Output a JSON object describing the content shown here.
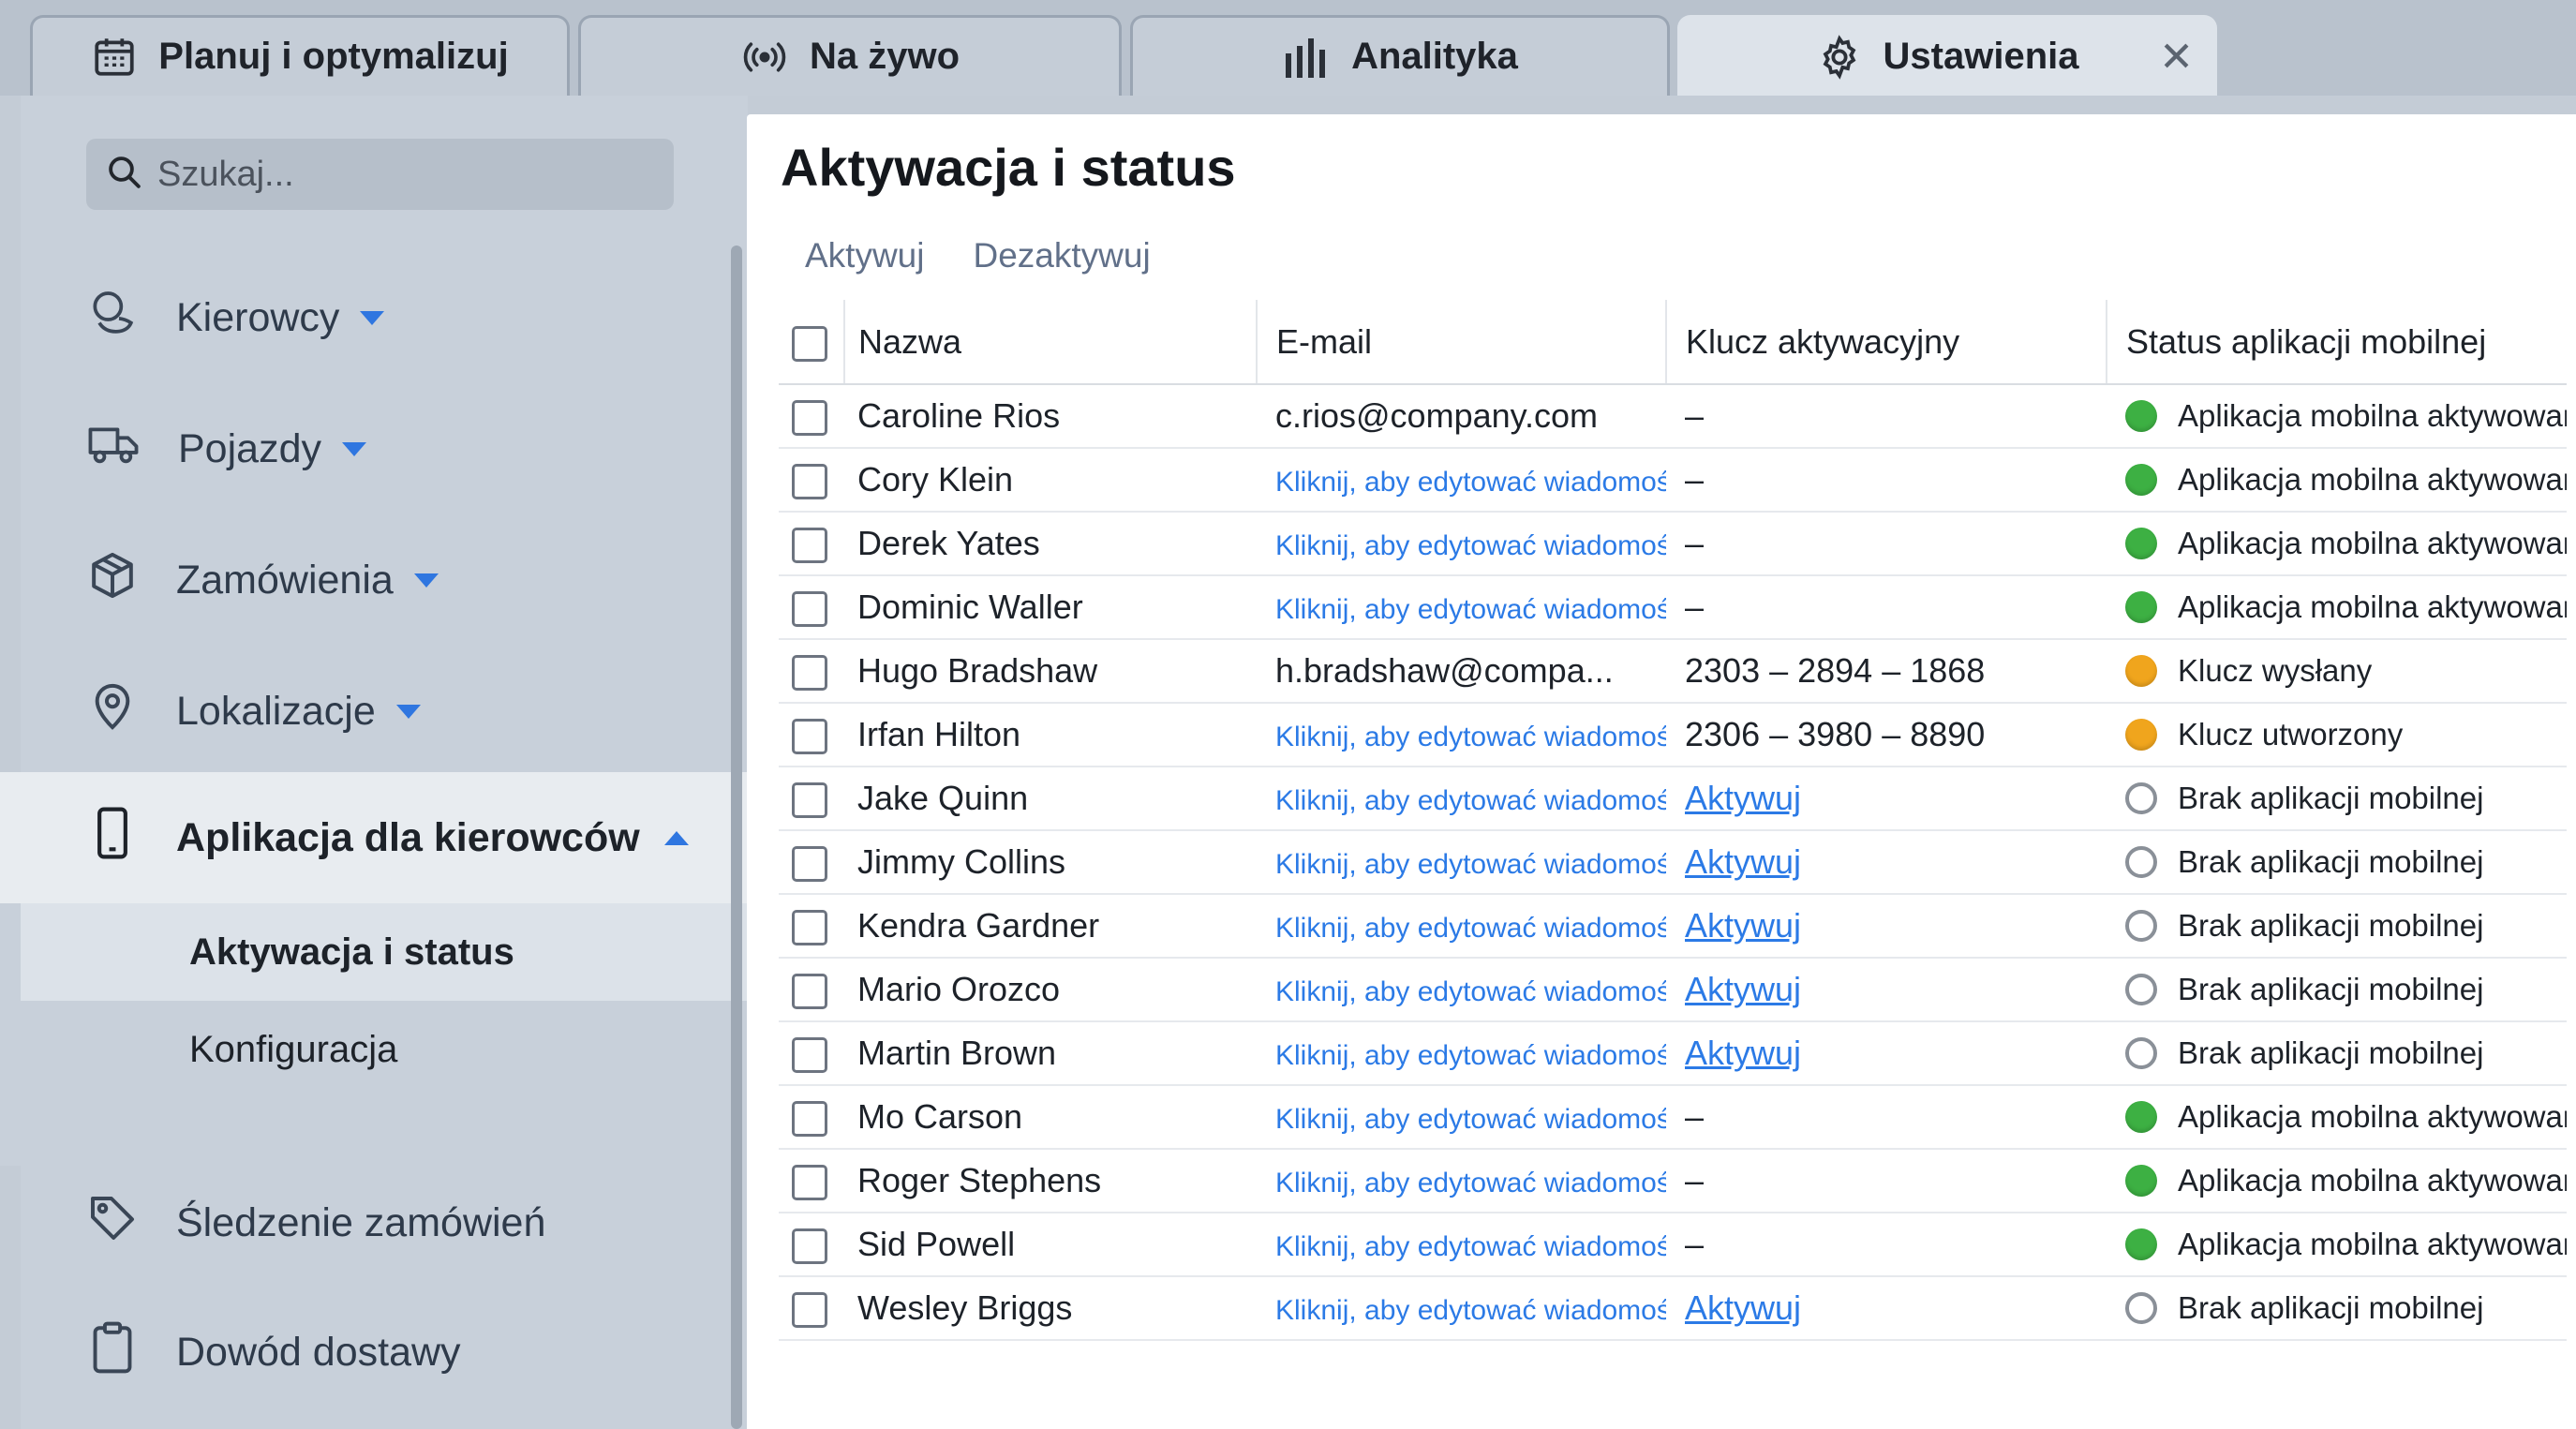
{
  "tabs": [
    {
      "label": "Planuj i optymalizuj",
      "icon": "calendar-icon"
    },
    {
      "label": "Na żywo",
      "icon": "broadcast-icon"
    },
    {
      "label": "Analityka",
      "icon": "bar-chart-icon"
    },
    {
      "label": "Ustawienia",
      "icon": "gear-icon",
      "active": true,
      "close": "✕"
    }
  ],
  "sidebar": {
    "search_placeholder": "Szukaj...",
    "items": [
      {
        "label": "Kierowcy",
        "icon": "drivers-icon"
      },
      {
        "label": "Pojazdy",
        "icon": "truck-icon"
      },
      {
        "label": "Zamówienia",
        "icon": "box-icon"
      },
      {
        "label": "Lokalizacje",
        "icon": "location-pin-icon"
      },
      {
        "label": "Aplikacja dla kierowców",
        "icon": "phone-icon"
      },
      {
        "label": "Śledzenie zamówień",
        "icon": "tag-icon"
      },
      {
        "label": "Dowód dostawy",
        "icon": "clipboard-icon"
      }
    ],
    "subitems": [
      {
        "label": "Aktywacja i status",
        "active": true
      },
      {
        "label": "Konfiguracja"
      }
    ]
  },
  "main": {
    "title": "Aktywacja i status",
    "actions": {
      "activate": "Aktywuj",
      "deactivate": "Dezaktywuj"
    },
    "columns": {
      "name": "Nazwa",
      "email": "E-mail",
      "key": "Klucz aktywacyjny",
      "status": "Status aplikacji mobilnej"
    },
    "rows": [
      {
        "name": "Caroline Rios",
        "email": "c.rios@company.com",
        "email_link": false,
        "key": "–",
        "key_link": false,
        "status": "Aplikacja mobilna aktywowana",
        "status_color": "green"
      },
      {
        "name": "Cory Klein",
        "email": "Kliknij, aby edytować wiadomość e-mail",
        "email_link": true,
        "key": "–",
        "key_link": false,
        "status": "Aplikacja mobilna aktywowana",
        "status_color": "green"
      },
      {
        "name": "Derek Yates",
        "email": "Kliknij, aby edytować wiadomość e-mail",
        "email_link": true,
        "key": "–",
        "key_link": false,
        "status": "Aplikacja mobilna aktywowana",
        "status_color": "green"
      },
      {
        "name": "Dominic Waller",
        "email": "Kliknij, aby edytować wiadomość e-mail",
        "email_link": true,
        "key": "–",
        "key_link": false,
        "status": "Aplikacja mobilna aktywowana",
        "status_color": "green"
      },
      {
        "name": "Hugo Bradshaw",
        "email": "h.bradshaw@compa...",
        "email_link": false,
        "key": "2303 – 2894 – 1868",
        "key_link": false,
        "status": "Klucz wysłany",
        "status_color": "orange"
      },
      {
        "name": "Irfan Hilton",
        "email": "Kliknij, aby edytować wiadomość e-mail",
        "email_link": true,
        "key": "2306 – 3980 – 8890",
        "key_link": false,
        "status": "Klucz utworzony",
        "status_color": "orange"
      },
      {
        "name": "Jake Quinn",
        "email": "Kliknij, aby edytować wiadomość e-mail",
        "email_link": true,
        "key": "Aktywuj",
        "key_link": true,
        "status": "Brak aplikacji mobilnej",
        "status_color": "empty"
      },
      {
        "name": "Jimmy Collins",
        "email": "Kliknij, aby edytować wiadomość e-mail",
        "email_link": true,
        "key": "Aktywuj",
        "key_link": true,
        "status": "Brak aplikacji mobilnej",
        "status_color": "empty"
      },
      {
        "name": "Kendra Gardner",
        "email": "Kliknij, aby edytować wiadomość e-mail",
        "email_link": true,
        "key": "Aktywuj",
        "key_link": true,
        "status": "Brak aplikacji mobilnej",
        "status_color": "empty"
      },
      {
        "name": "Mario Orozco",
        "email": "Kliknij, aby edytować wiadomość e-mail",
        "email_link": true,
        "key": "Aktywuj",
        "key_link": true,
        "status": "Brak aplikacji mobilnej",
        "status_color": "empty"
      },
      {
        "name": "Martin Brown",
        "email": "Kliknij, aby edytować wiadomość e-mail",
        "email_link": true,
        "key": "Aktywuj",
        "key_link": true,
        "status": "Brak aplikacji mobilnej",
        "status_color": "empty"
      },
      {
        "name": "Mo Carson",
        "email": "Kliknij, aby edytować wiadomość e-mail",
        "email_link": true,
        "key": "–",
        "key_link": false,
        "status": "Aplikacja mobilna aktywowana",
        "status_color": "green"
      },
      {
        "name": "Roger Stephens",
        "email": "Kliknij, aby edytować wiadomość e-mail",
        "email_link": true,
        "key": "–",
        "key_link": false,
        "status": "Aplikacja mobilna aktywowana",
        "status_color": "green"
      },
      {
        "name": "Sid Powell",
        "email": "Kliknij, aby edytować wiadomość e-mail",
        "email_link": true,
        "key": "–",
        "key_link": false,
        "status": "Aplikacja mobilna aktywowana",
        "status_color": "green"
      },
      {
        "name": "Wesley Briggs",
        "email": "Kliknij, aby edytować wiadomość e-mail",
        "email_link": true,
        "key": "Aktywuj",
        "key_link": true,
        "status": "Brak aplikacji mobilnej",
        "status_color": "empty"
      }
    ]
  },
  "colors": {
    "accent": "#2f76e0",
    "link": "#2b7ae6",
    "green": "#3db043",
    "orange": "#f0a51d"
  }
}
